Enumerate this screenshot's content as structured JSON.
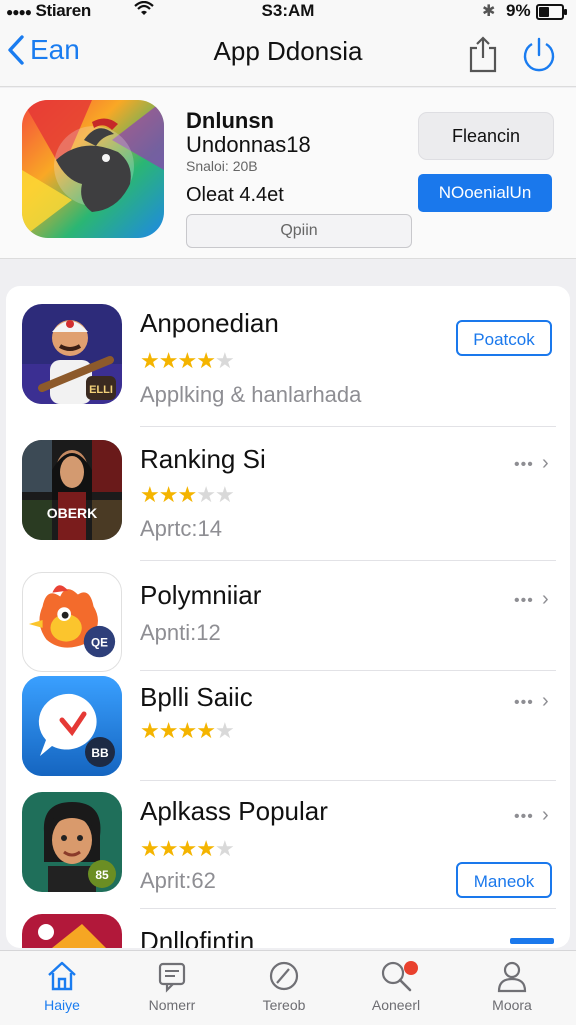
{
  "status_bar": {
    "carrier": "Stiaren",
    "time": "S3:AM",
    "battery_pct": "9%",
    "battery_level": 0.5
  },
  "nav": {
    "back_label": "Ean",
    "title": "App Ddonsia",
    "share_icon": "share-icon",
    "power_icon": "power-icon"
  },
  "featured": {
    "name": "Dnlunsn",
    "subtitle": "Undonnas18",
    "meta": "Snaloi: 20B",
    "rating_text": "Oleat 4.4et",
    "open_label": "Qpiin",
    "secondary_label": "Fleancin",
    "primary_label": "NOoenialUn"
  },
  "apps": [
    {
      "name": "Anponedian",
      "stars": 3.5,
      "sub": "Applking & hanlarhada",
      "button": "Poatcok",
      "badge": "ELLI"
    },
    {
      "name": "Ranking Si",
      "stars": 3.0,
      "sub": "Aprtc:14",
      "badge": "OBERK"
    },
    {
      "name": "Polymniiar",
      "sub": "Apnti:12",
      "badge": "QE"
    },
    {
      "name": "Bplli Saiic",
      "stars": 3.5,
      "badge": "BB"
    },
    {
      "name": "Aplkass Popular",
      "stars": 3.5,
      "sub": "Aprit:62",
      "button": "Maneok",
      "badge": "85"
    },
    {
      "name": "Dnllofintin"
    }
  ],
  "tabs": [
    {
      "label": "Haiye",
      "icon": "home-icon",
      "active": true
    },
    {
      "label": "Nomerr",
      "icon": "messages-icon"
    },
    {
      "label": "Tereob",
      "icon": "compass-icon"
    },
    {
      "label": "Aoneerl",
      "icon": "search-icon"
    },
    {
      "label": "Moora",
      "icon": "profile-icon"
    }
  ],
  "colors": {
    "accent": "#1a78ec",
    "star": "#f4b400",
    "badge_red": "#e9412e"
  }
}
